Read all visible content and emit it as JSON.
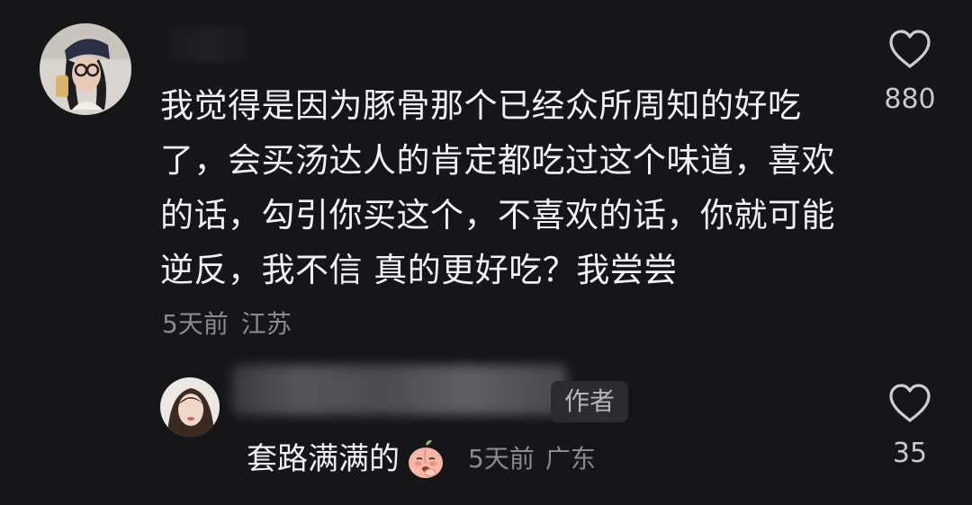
{
  "comment": {
    "text": "我觉得是因为豚骨那个已经众所周知的好吃了，会买汤达人的肯定都吃过这个味道，喜欢的话，勾引你买这个，不喜欢的话，你就可能逆反，我不信 真的更好吃？我尝尝",
    "time": "5天前",
    "location": "江苏",
    "likes": "880"
  },
  "reply": {
    "author_badge": "作者",
    "text": "套路满满的",
    "emoji": "peach-face-emoji",
    "time": "5天前",
    "location": "广东",
    "likes": "35"
  },
  "colors": {
    "background": "#161619",
    "primary_text": "#f1f1f3",
    "secondary_text": "#8a8a8f",
    "badge_bg": "#2c2c30"
  },
  "icons": {
    "like": "heart-outline-icon"
  }
}
